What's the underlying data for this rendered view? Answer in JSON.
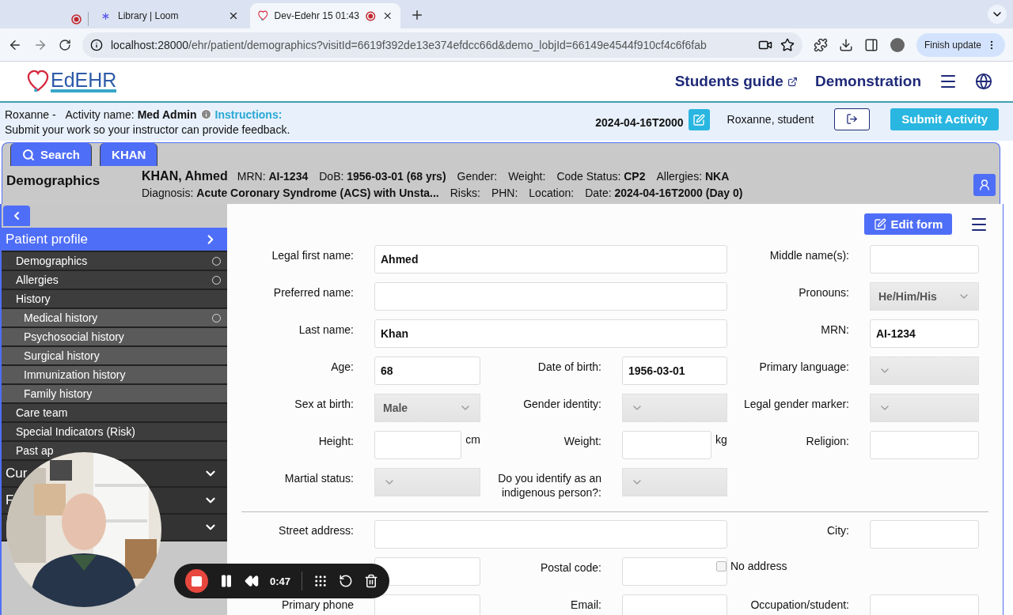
{
  "browser": {
    "tabs": [
      {
        "kind": "pinned",
        "recording": true,
        "selected": false
      },
      {
        "kind": "page",
        "title": "Library | Loom",
        "recording": false,
        "selected": false
      },
      {
        "kind": "page",
        "title": "Dev-Edehr 15 01:43",
        "recording": true,
        "selected": true
      }
    ],
    "url": {
      "host": "localhost:28000",
      "path": "/ehr/patient/demographics?visitId=6619f392de13e374efdcc66d&demo_lobjId=66149e4544f910cf4c6f6fab"
    },
    "update_button": "Finish update"
  },
  "header": {
    "logo": "EdEHR",
    "links": [
      {
        "label": "Students guide",
        "external": true
      },
      {
        "label": "Demonstration",
        "external": false
      }
    ]
  },
  "activity": {
    "student": "Roxanne -",
    "activity_label": "Activity name:",
    "activity_name": "Med Admin",
    "instructions_label": "Instructions:",
    "instructions": "Submit your work so your instructor can provide feedback.",
    "date": "2024-04-16T2000",
    "user": "Roxanne, student",
    "submit": "Submit Activity"
  },
  "banner": {
    "tabs": [
      {
        "kind": "search",
        "label": "Search"
      },
      {
        "kind": "patient",
        "label": "KHAN"
      }
    ],
    "page_title": "Demographics",
    "patient_name": "KHAN, Ahmed",
    "lines": [
      [
        {
          "label": "MRN:",
          "value": "AI-1234"
        },
        {
          "label": "DoB:",
          "value": "1956-03-01 (68 yrs)"
        },
        {
          "label": "Gender:"
        },
        {
          "label": "Weight:"
        },
        {
          "label": "Code Status:",
          "value": "CP2"
        },
        {
          "label": "Allergies:",
          "value": "NKA"
        }
      ],
      [
        {
          "label": "Diagnosis:",
          "value": "Acute Coronary Syndrome (ACS) with Unsta..."
        },
        {
          "label": "Risks:"
        },
        {
          "label": "PHN:"
        },
        {
          "label": "Location:"
        },
        {
          "label": "Date:",
          "value": "2024-04-16T2000 (Day 0)"
        }
      ]
    ]
  },
  "sidebar": {
    "sections": [
      {
        "title": "Patient profile",
        "expanded": true,
        "items": [
          {
            "label": "Demographics",
            "indicator": true
          },
          {
            "label": "Allergies",
            "indicator": true
          },
          {
            "label": "History",
            "indicator": false,
            "children": [
              {
                "label": "Medical history",
                "indicator": true
              },
              {
                "label": "Psychosocial history",
                "indicator": false
              },
              {
                "label": "Surgical history",
                "indicator": false
              },
              {
                "label": "Immunization history",
                "indicator": false
              },
              {
                "label": "Family history",
                "indicator": false
              }
            ]
          },
          {
            "label": "Care team",
            "indicator": false
          },
          {
            "label": "Special Indicators (Risk)",
            "indicator": false
          },
          {
            "label": "Past ap",
            "indicator": false
          }
        ]
      },
      {
        "title": "Cur",
        "expanded": false
      },
      {
        "title": "F",
        "expanded": false
      },
      {
        "expanded": false
      }
    ]
  },
  "form": {
    "edit_button": "Edit form",
    "sections": [
      [
        [
          {
            "kind": "wide_text",
            "label": "Legal first name:",
            "value": "Ahmed"
          },
          {
            "kind": "text",
            "label": "Middle name(s):"
          }
        ],
        [
          {
            "kind": "wide_text",
            "label": "Preferred name:"
          },
          {
            "kind": "select",
            "label": "Pronouns:",
            "value": "He/Him/His"
          }
        ],
        [
          {
            "kind": "wide_text",
            "label": "Last name:",
            "value": "Khan"
          },
          {
            "kind": "text",
            "label": "MRN:",
            "value": "AI-1234"
          }
        ],
        [
          {
            "kind": "text",
            "label": "Age:",
            "value": "68"
          },
          {
            "kind": "text",
            "label": "Date of birth:",
            "value": "1956-03-01"
          },
          {
            "kind": "select",
            "label": "Primary language:"
          }
        ],
        [
          {
            "kind": "select",
            "label": "Sex at birth:",
            "value": "Male"
          },
          {
            "kind": "select",
            "label": "Gender identity:"
          },
          {
            "kind": "select",
            "label": "Legal gender marker:"
          }
        ],
        [
          {
            "kind": "text",
            "label": "Height:",
            "unit": "cm"
          },
          {
            "kind": "text",
            "label": "Weight:",
            "unit": "kg"
          },
          {
            "kind": "text",
            "label": "Religion:"
          }
        ],
        [
          {
            "kind": "select",
            "label": "Martial status:"
          },
          {
            "kind": "select",
            "label": "Do you identify as an indigenous person?:"
          }
        ]
      ],
      [
        [
          {
            "kind": "wide_text",
            "label": "Street address:"
          },
          {
            "kind": "text",
            "label": "City:"
          }
        ],
        [
          {
            "kind": "text"
          },
          {
            "kind": "text",
            "label": "Postal code:"
          },
          {
            "kind": "checkbox",
            "label": "No address",
            "checked": false
          }
        ],
        [
          {
            "kind": "text",
            "label": "Primary phone"
          },
          {
            "kind": "text",
            "label": "Email:"
          },
          {
            "kind": "text",
            "label": "Occupation/student:"
          }
        ]
      ]
    ]
  },
  "recorder": {
    "time": "0:47"
  }
}
